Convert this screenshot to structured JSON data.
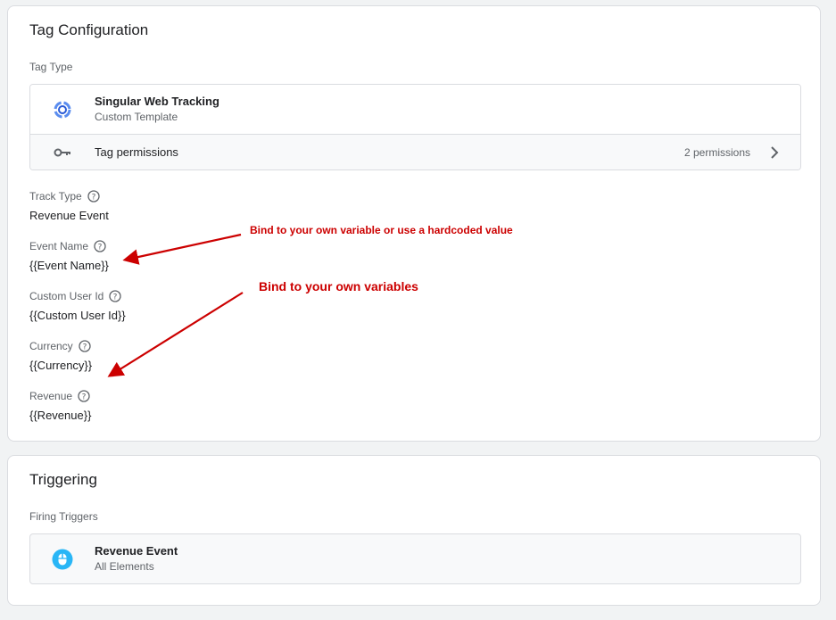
{
  "tag_configuration": {
    "title": "Tag Configuration",
    "tag_type_label": "Tag Type",
    "tag_type": {
      "name": "Singular Web Tracking",
      "subtitle": "Custom Template",
      "icon": "singular-logo-icon"
    },
    "permissions": {
      "label": "Tag permissions",
      "count": "2 permissions",
      "icon": "key-icon"
    },
    "fields": [
      {
        "label": "Track Type",
        "value": "Revenue Event"
      },
      {
        "label": "Event Name",
        "value": "{{Event Name}}"
      },
      {
        "label": "Custom User Id",
        "value": "{{Custom User Id}}"
      },
      {
        "label": "Currency",
        "value": "{{Currency}}"
      },
      {
        "label": "Revenue",
        "value": "{{Revenue}}"
      }
    ]
  },
  "annotations": {
    "note1": "Bind to your own variable or use a hardcoded value",
    "note2": "Bind to your own variables",
    "color": "#cc0000"
  },
  "triggering": {
    "title": "Triggering",
    "firing_label": "Firing Triggers",
    "trigger": {
      "name": "Revenue Event",
      "subtitle": "All Elements",
      "icon": "mouse-click-icon",
      "icon_color": "#29b6f6"
    }
  }
}
